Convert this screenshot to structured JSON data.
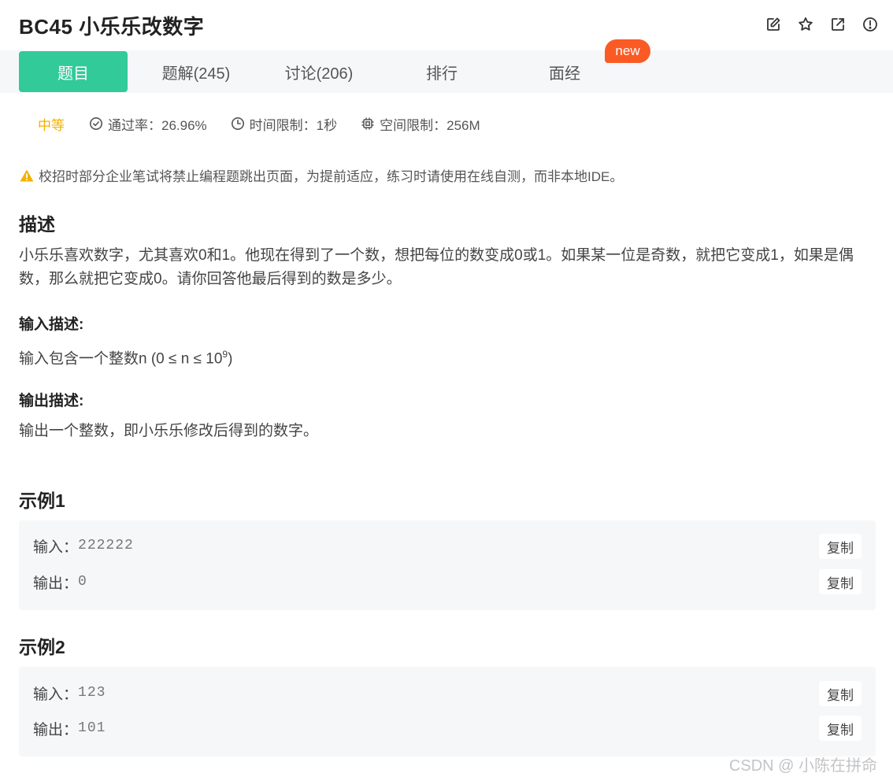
{
  "header": {
    "title": "BC45  小乐乐改数字",
    "actions": [
      "edit-icon",
      "star-icon",
      "share-icon",
      "report-icon"
    ]
  },
  "tabs": [
    {
      "label": "题目",
      "active": true
    },
    {
      "label": "题解(245)",
      "active": false
    },
    {
      "label": "讨论(206)",
      "active": false
    },
    {
      "label": "排行",
      "active": false
    },
    {
      "label": "面经",
      "active": false
    }
  ],
  "new_badge": "new",
  "meta": {
    "difficulty": "中等",
    "pass_rate": "通过率：26.96%",
    "time_limit": "时间限制：1秒",
    "memory_limit": "空间限制：256M"
  },
  "notice": "校招时部分企业笔试将禁止编程题跳出页面，为提前适应，练习时请使用在线自测，而非本地IDE。",
  "description": {
    "heading": "描述",
    "text": "小乐乐喜欢数字，尤其喜欢0和1。他现在得到了一个数，想把每位的数变成0或1。如果某一位是奇数，就把它变成1，如果是偶数，那么就把它变成0。请你回答他最后得到的数是多少。"
  },
  "input_desc": {
    "heading": "输入描述:",
    "text": "输入包含一个整数n (0 ≤ n ≤ 10",
    "sup": "9",
    "close": ")"
  },
  "output_desc": {
    "heading": "输出描述:",
    "text": "输出一个整数，即小乐乐修改后得到的数字。"
  },
  "examples": [
    {
      "heading": "示例1",
      "input_label": "输入：",
      "input": "222222",
      "output_label": "输出：",
      "output": "0",
      "copy": "复制"
    },
    {
      "heading": "示例2",
      "input_label": "输入：",
      "input": "123",
      "output_label": "输出：",
      "output": "101",
      "copy": "复制"
    }
  ],
  "watermark": "CSDN @  小陈在拼命",
  "colors": {
    "accent": "#32ca99",
    "badge": "#fa5b24",
    "difficulty": "#f5b000",
    "warning": "#f5b000"
  }
}
